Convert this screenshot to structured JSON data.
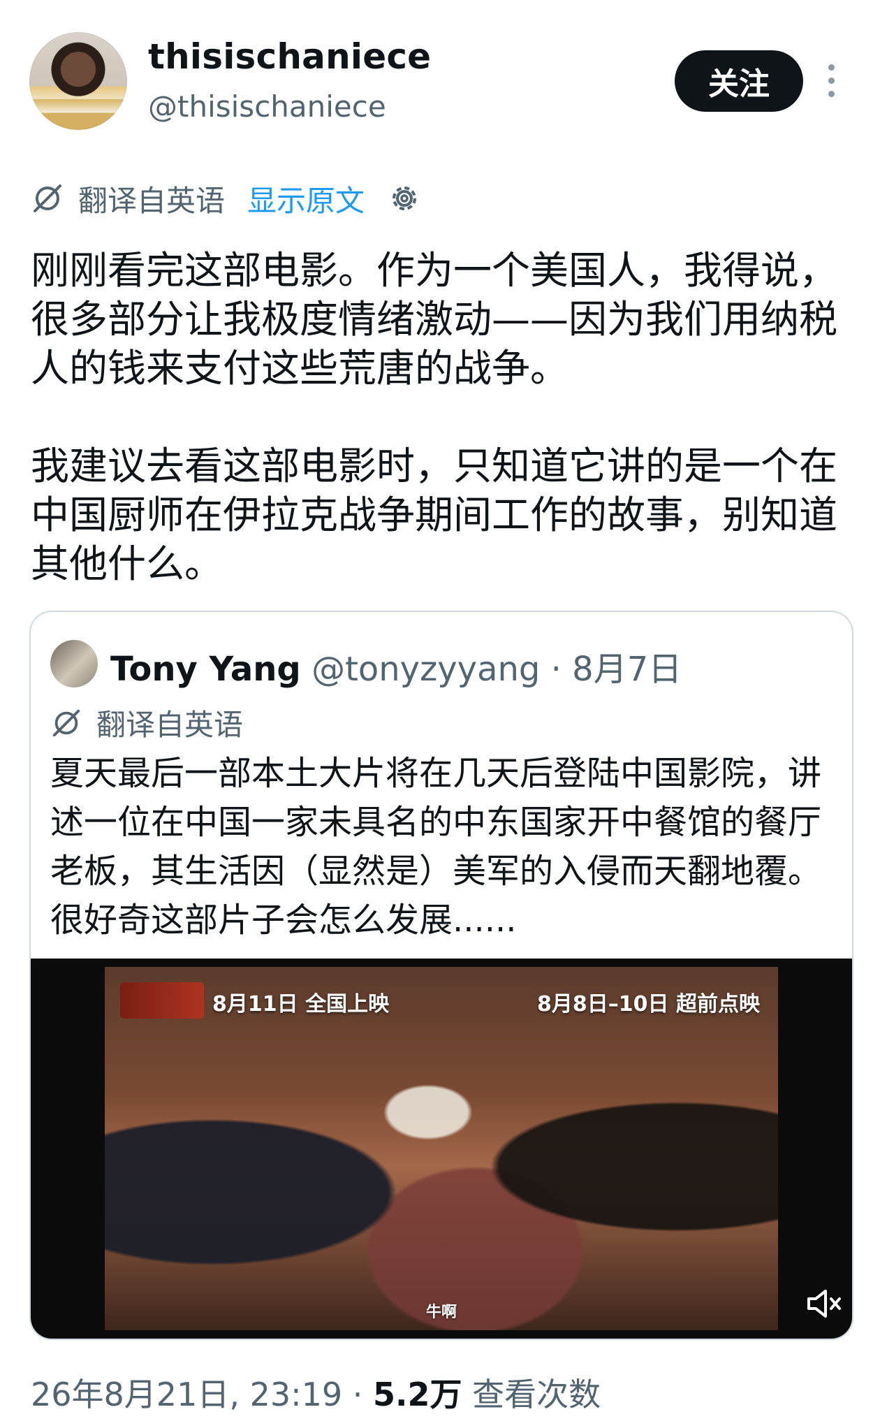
{
  "author": {
    "display_name": "thisischaniece",
    "handle": "@thisischaniece"
  },
  "follow_label": "关注",
  "translation": {
    "label": "翻译自英语",
    "show_original": "显示原文"
  },
  "tweet": {
    "paragraphs": [
      "刚刚看完这部电影。作为一个美国人，我得说，很多部分让我极度情绪激动——因为我们用纳税人的钱来支付这些荒唐的战争。",
      "我建议去看这部电影时，只知道它讲的是一个在中国厨师在伊拉克战争期间工作的故事，别知道其他什么。"
    ]
  },
  "quote": {
    "name": "Tony Yang",
    "handle": "@tonyzyyang",
    "separator": " · ",
    "date": "8月7日",
    "translation_label": "翻译自英语",
    "text": "夏天最后一部本土大片将在几天后登陆中国影院，讲述一位在中国一家未具名的中东国家开中餐馆的餐厅老板，其生活因（显然是）美军的入侵而天翻地覆。很好奇这部片子会怎么发展......",
    "video": {
      "release_text": "8月11日 全国上映",
      "preview_text": "8月8日–10日 超前点映",
      "subtitle": "牛啊"
    }
  },
  "footer": {
    "timestamp": "26年8月21日, 23:19",
    "separator": " · ",
    "views_count": "5.2万",
    "views_label": " 查看次数"
  },
  "colors": {
    "text": "#0f1419",
    "secondary": "#536471",
    "link": "#1d9bf0",
    "border": "#cfd9de"
  },
  "icons": [
    "translate-icon",
    "gear-icon",
    "more-icon",
    "mute-icon"
  ]
}
